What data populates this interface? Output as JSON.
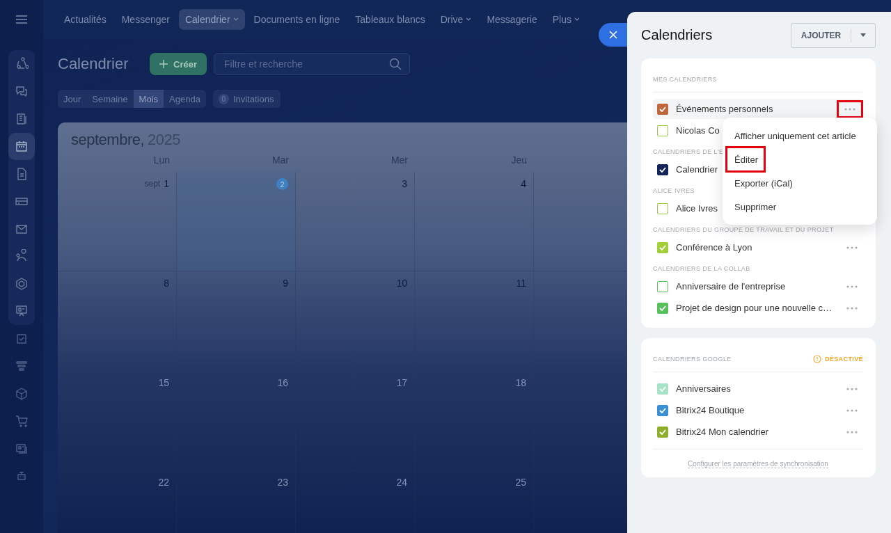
{
  "sidebar": {
    "items": [
      {
        "selected": false
      },
      {
        "selected": false
      },
      {
        "selected": false
      },
      {
        "selected": true
      },
      {
        "selected": false
      },
      {
        "selected": false
      },
      {
        "selected": false
      },
      {
        "selected": false
      },
      {
        "selected": false
      },
      {
        "selected": false
      },
      {
        "selected": false
      },
      {
        "selected": false
      },
      {
        "selected": false
      },
      {
        "selected": false
      },
      {
        "selected": false
      },
      {
        "selected": false
      }
    ]
  },
  "topnav": {
    "tabs": [
      {
        "label": "Actualités",
        "selected": false,
        "dropdown": false
      },
      {
        "label": "Messenger",
        "selected": false,
        "dropdown": false
      },
      {
        "label": "Calendrier",
        "selected": true,
        "dropdown": true
      },
      {
        "label": "Documents en ligne",
        "selected": false,
        "dropdown": false
      },
      {
        "label": "Tableaux blancs",
        "selected": false,
        "dropdown": false
      },
      {
        "label": "Drive",
        "selected": false,
        "dropdown": true
      },
      {
        "label": "Messagerie",
        "selected": false,
        "dropdown": false
      },
      {
        "label": "Plus",
        "selected": false,
        "dropdown": true
      }
    ]
  },
  "page": {
    "title": "Calendrier",
    "create_button": "Créer",
    "search": {
      "placeholder": "Filtre et recherche"
    },
    "views": [
      {
        "label": "Jour",
        "selected": false
      },
      {
        "label": "Semaine",
        "selected": false
      },
      {
        "label": "Mois",
        "selected": true
      },
      {
        "label": "Agenda",
        "selected": false
      }
    ],
    "invitations": {
      "count": "0",
      "label": "Invitations"
    }
  },
  "calendar": {
    "month": "septembre,",
    "year": "2025",
    "weekdays": [
      "Lun",
      "Mar",
      "Mer",
      "Jeu"
    ],
    "weeks": [
      {
        "days": [
          {
            "prefix": "sept",
            "label": "1",
            "today": false
          },
          {
            "label": "2",
            "today": true
          },
          {
            "label": "3",
            "today": false
          },
          {
            "label": "4",
            "today": false
          }
        ]
      },
      {
        "days": [
          {
            "label": "8",
            "today": false
          },
          {
            "label": "9",
            "today": false
          },
          {
            "label": "10",
            "today": false
          },
          {
            "label": "11",
            "today": false
          }
        ]
      },
      {
        "days": [
          {
            "label": "15",
            "today": false
          },
          {
            "label": "16",
            "today": false
          },
          {
            "label": "17",
            "today": false
          },
          {
            "label": "18",
            "today": false
          }
        ]
      },
      {
        "days": [
          {
            "label": "22",
            "today": false
          },
          {
            "label": "23",
            "today": false
          },
          {
            "label": "24",
            "today": false
          },
          {
            "label": "25",
            "today": false
          }
        ]
      }
    ]
  },
  "panel": {
    "title": "Calendriers",
    "add_button": "AJOUTER",
    "cards": [
      {
        "sections": [
          {
            "header": "MES CALENDRIERS",
            "divider": true,
            "items": [
              {
                "label": "Événements personnels",
                "color": "#c0683a",
                "checked": true,
                "hovered": true,
                "more": true,
                "highlighted": true
              },
              {
                "label": "Nicolas Co",
                "color": "#9bc53d",
                "checked": false,
                "hovered": false
              }
            ]
          },
          {
            "header": "CALENDRIERS DE L'E",
            "divider": false,
            "items": [
              {
                "label": "Calendrier",
                "color": "#13255a",
                "checked": true,
                "hovered": false
              }
            ]
          },
          {
            "header": "ALICE IVRES",
            "divider": false,
            "items": [
              {
                "label": "Alice Ivres",
                "color": "#9bc53d",
                "checked": false,
                "hovered": false
              }
            ]
          },
          {
            "header": "CALENDRIERS DU GROUPE DE TRAVAIL ET DU PROJET",
            "divider": false,
            "items": [
              {
                "label": "Conférence à Lyon",
                "color": "#a3cf3a",
                "checked": true,
                "hovered": false,
                "more": true,
                "highlighted": false
              }
            ]
          },
          {
            "header": "CALENDRIERS DE LA COLLAB",
            "divider": false,
            "items": [
              {
                "label": "Anniversaire de l'entreprise",
                "color": "#56c15a",
                "checked": false,
                "hovered": false,
                "more": true,
                "highlighted": false
              },
              {
                "label": "Projet de design pour une nouvelle c…",
                "color": "#56c15a",
                "checked": true,
                "hovered": false,
                "more": true,
                "highlighted": false
              }
            ]
          }
        ]
      },
      {
        "sections": [
          {
            "header": "CALENDRIERS GOOGLE",
            "status": "DÉSACTIVÉ",
            "divider": true,
            "items": [
              {
                "label": "Anniversaires",
                "color": "#a6e3c6",
                "checked": true,
                "hovered": false,
                "more": true,
                "highlighted": false
              },
              {
                "label": "Bitrix24 Boutique",
                "color": "#3b8fd4",
                "checked": true,
                "hovered": false,
                "more": true,
                "highlighted": false
              },
              {
                "label": "Bitrix24 Mon calendrier",
                "color": "#8fae2e",
                "checked": true,
                "hovered": false,
                "more": true,
                "highlighted": false
              }
            ]
          }
        ],
        "footer_link": "Configurer les paramètres de synchronisation"
      }
    ],
    "menu": {
      "items": [
        {
          "label": "Afficher uniquement cet article",
          "highlighted": false
        },
        {
          "label": "Éditer",
          "highlighted": true
        },
        {
          "label": "Exporter (iCal)",
          "highlighted": false
        },
        {
          "label": "Supprimer",
          "highlighted": false
        }
      ]
    }
  }
}
